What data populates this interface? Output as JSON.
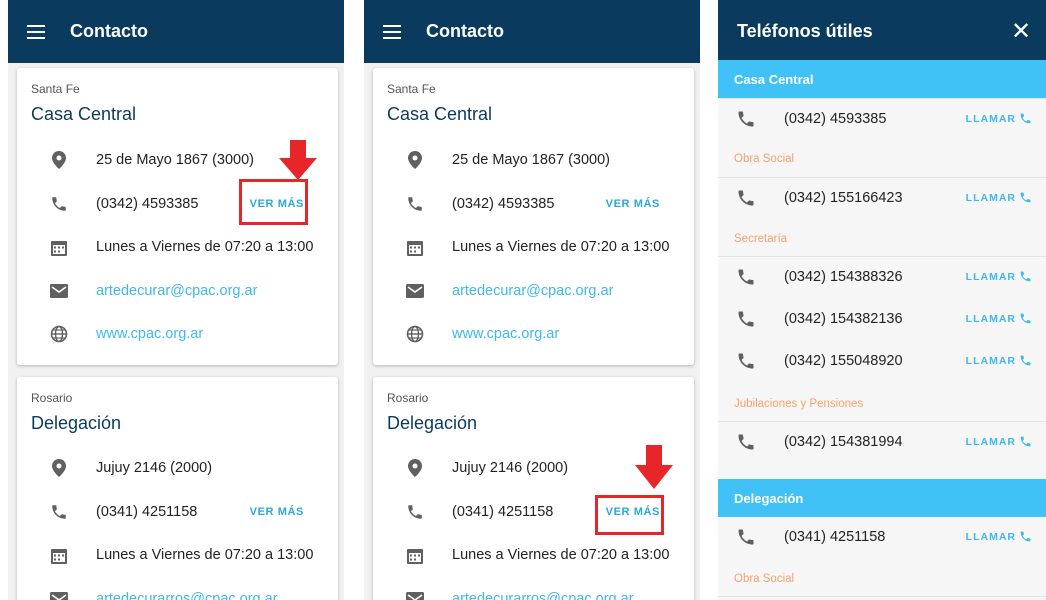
{
  "panel1": {
    "title": "Contacto",
    "card1": {
      "city": "Santa Fe",
      "office": "Casa Central",
      "address": "25 de Mayo 1867 (3000)",
      "phone": "(0342) 4593385",
      "ver_mas": "VER MÁS",
      "hours": "Lunes a Viernes de 07:20 a 13:00",
      "email": "artedecurar@cpac.org.ar",
      "web": "www.cpac.org.ar"
    },
    "card2": {
      "city": "Rosario",
      "office": "Delegación",
      "address": "Jujuy 2146 (2000)",
      "phone": "(0341) 4251158",
      "ver_mas": "VER MÁS",
      "hours": "Lunes a Viernes de 07:20 a 13:00",
      "email": "artedecurarros@cpac.org.ar"
    }
  },
  "panel2": {
    "title": "Contacto",
    "card1": {
      "city": "Santa Fe",
      "office": "Casa Central",
      "address": "25 de Mayo 1867 (3000)",
      "phone": "(0342) 4593385",
      "ver_mas": "VER MÁS",
      "hours": "Lunes a Viernes de 07:20 a 13:00",
      "email": "artedecurar@cpac.org.ar",
      "web": "www.cpac.org.ar"
    },
    "card2": {
      "city": "Rosario",
      "office": "Delegación",
      "address": "Jujuy 2146 (2000)",
      "phone": "(0341) 4251158",
      "ver_mas": "VER MÁS",
      "hours": "Lunes a Viernes de 07:20 a 13:00",
      "email": "artedecurarros@cpac.org.ar"
    }
  },
  "panel3": {
    "title": "Teléfonos útiles",
    "close_icon": "close-icon",
    "sections": [
      {
        "name": "Casa Central"
      },
      {
        "name": "Delegación"
      }
    ],
    "categories": [
      "Obra Social",
      "Secretaría",
      "Jubilaciones y Pensiones",
      "Obra Social"
    ],
    "phones": [
      "(0342) 4593385",
      "(0342) 155166423",
      "(0342) 154388326",
      "(0342) 154382136",
      "(0342) 155048920",
      "(0342) 154381994",
      "(0341) 4251158"
    ],
    "llamar": "LLAMAR"
  },
  "colors": {
    "appbar": "#0a3b5f",
    "accent": "#41c2f6",
    "link": "#3fb8ee",
    "highlight": "#e8262a",
    "category": "#f4a26e"
  },
  "icons": [
    "menu-icon",
    "location-pin-icon",
    "phone-icon",
    "calendar-icon",
    "email-icon",
    "globe-icon",
    "arrow-down-icon",
    "close-icon"
  ]
}
